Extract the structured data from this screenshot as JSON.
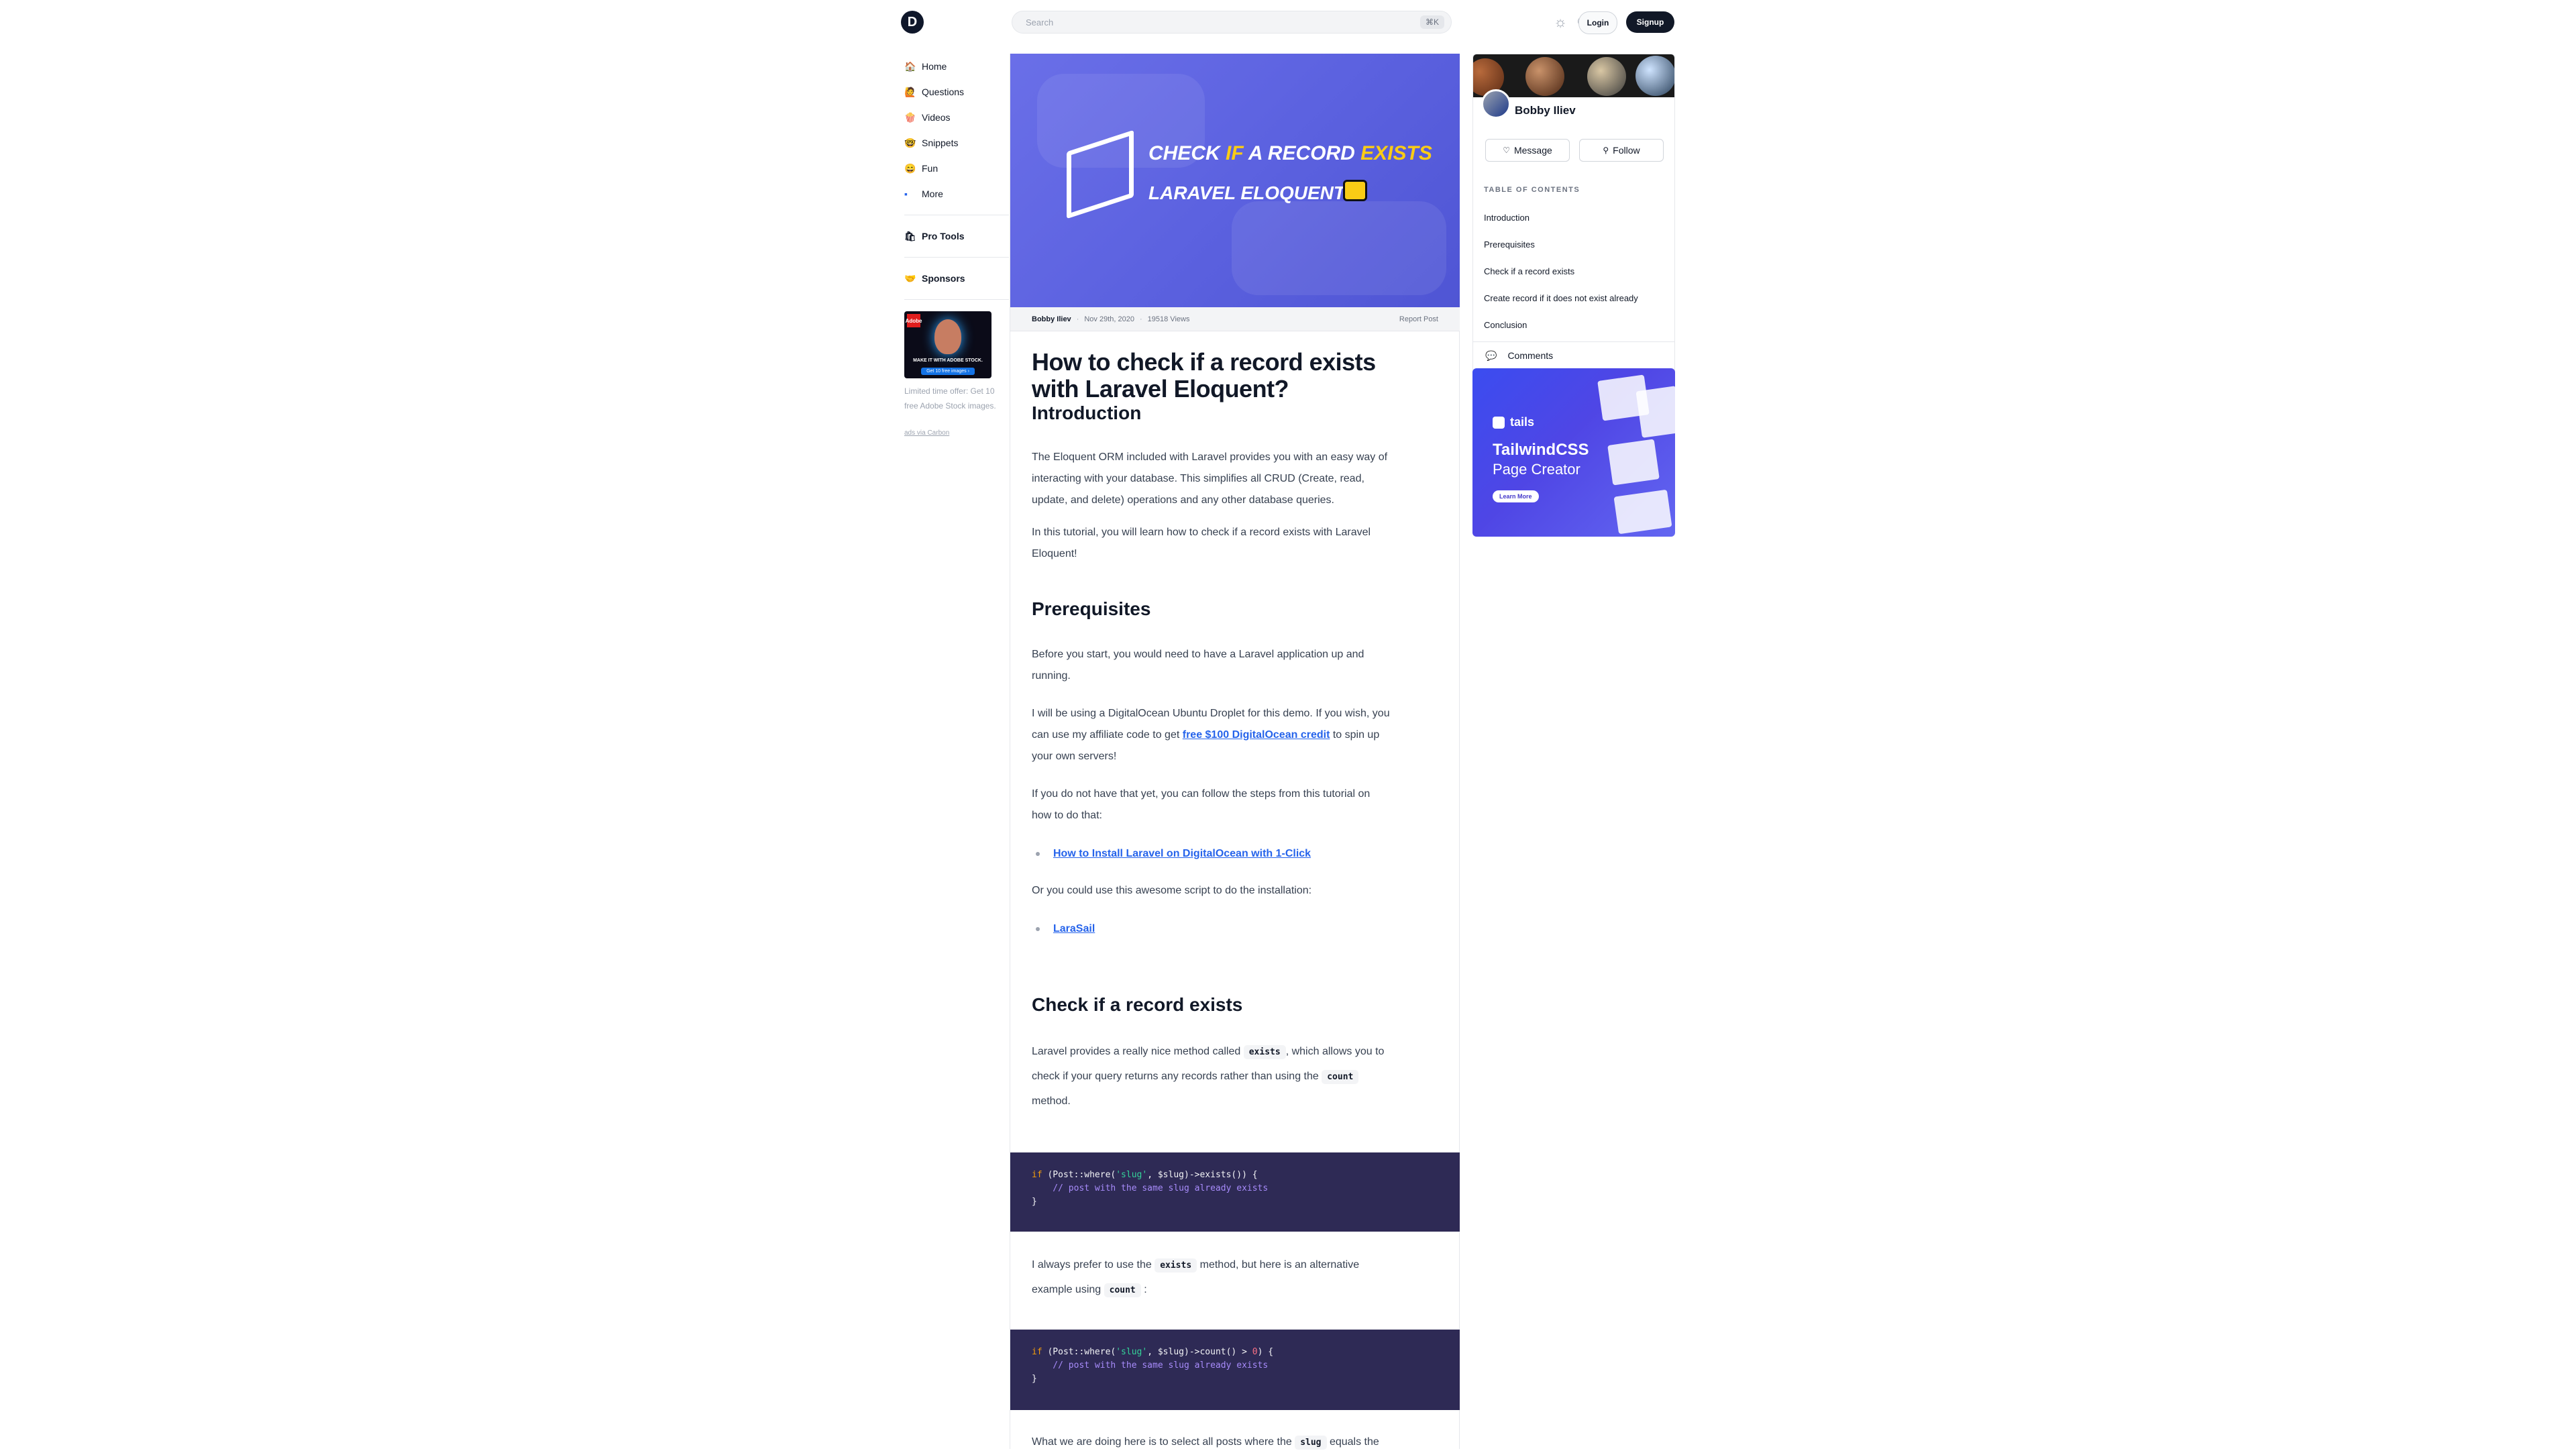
{
  "header": {
    "logo": "D",
    "search_placeholder": "Search",
    "search_shortcut": "⌘K",
    "theme_toggle": "☼ ☾",
    "login_label": "Login",
    "signup_label": "Signup"
  },
  "sidebar": {
    "items": [
      {
        "icon": "🏠",
        "label": "Home"
      },
      {
        "icon": "🙋",
        "label": "Questions"
      },
      {
        "icon": "🍿",
        "label": "Videos"
      },
      {
        "icon": "🤓",
        "label": "Snippets"
      },
      {
        "icon": "😄",
        "label": "Fun"
      },
      {
        "icon": "▪",
        "label": "More"
      }
    ],
    "pro_tools": {
      "icon": "🛍",
      "label": "Pro Tools"
    },
    "sponsors": {
      "icon": "🤝",
      "label": "Sponsors"
    },
    "ad": {
      "caption": "MAKE IT WITH ADOBE STOCK.",
      "cta": "Get 10 free images ›",
      "badge": "Adobe",
      "text": "Limited time offer: Get 10 free Adobe Stock images.",
      "link": "ads via Carbon"
    }
  },
  "article": {
    "hero": {
      "line1_a": "CHECK ",
      "line1_b": "IF",
      "line1_c": " A RECORD ",
      "line1_d": "EXISTS",
      "line2": "LARAVEL ELOQUENT"
    },
    "meta": {
      "author": "Bobby Iliev",
      "date": "Nov 29th, 2020",
      "views": "19518 Views",
      "report": "Report Post"
    },
    "title_line1": "How to check if a record exists",
    "title_line2": "with Laravel Eloquent?",
    "intro_heading": "Introduction",
    "intro_p1_l1": "The Eloquent ORM included with Laravel provides you with an easy way of",
    "intro_p1_l2": "interacting with your database. This simplifies all CRUD (Create, read,",
    "intro_p1_l3": "update, and delete) operations and any other database queries.",
    "intro_p2_l1": "In this tutorial, you will learn how to check if a record exists with Laravel",
    "intro_p2_l2": "Eloquent!",
    "prereq_heading": "Prerequisites",
    "prereq_p1_l1": "Before you start, you would need to have a Laravel application up and",
    "prereq_p1_l2": "running.",
    "prereq_p2_l1": "I will be using a DigitalOcean Ubuntu Droplet for this demo. If you wish, you",
    "prereq_p2_l2a": "can use my affiliate code to get ",
    "prereq_p2_link": "free $100 DigitalOcean credit",
    "prereq_p2_l2b": " to spin up",
    "prereq_p2_l3": "your own servers!",
    "prereq_p3_l1": "If you do not have that yet, you can follow the steps from this tutorial on",
    "prereq_p3_l2": "how to do that:",
    "link_install": "How to Install Laravel on DigitalOcean with 1-Click",
    "prereq_p4": "Or you could use this awesome script to do the installation:",
    "link_larasail": "LaraSail",
    "check_heading": "Check if a record exists",
    "check_p1_a": "Laravel provides a really nice method called ",
    "check_p1_code1": "exists",
    "check_p1_b": ", which allows you to",
    "check_p1_c": "check if your query returns any records rather than using the ",
    "check_p1_code2": "count",
    "check_p1_d": "method.",
    "code1": {
      "kw": "if",
      "a": " (Post::where(",
      "str": "'slug'",
      "b": ", $slug)->exists()) {",
      "comment": "    // post with the same slug already exists",
      "close": "}"
    },
    "alt_p_a": "I always prefer to use the ",
    "alt_p_code1": "exists",
    "alt_p_b": " method, but here is an alternative",
    "alt_p_c": "example using ",
    "alt_p_code2": "count",
    "alt_p_d": " :",
    "code2": {
      "kw": "if",
      "a": " (Post::where(",
      "str": "'slug'",
      "b": ", $slug)->count() > ",
      "num": "0",
      "c": ") {",
      "comment": "    // post with the same slug already exists",
      "close": "}"
    },
    "last_p_a": "What we are doing here is to select all posts where the ",
    "last_p_code": "slug",
    "last_p_b": " equals the"
  },
  "profile": {
    "name": "Bobby Iliev",
    "message_label": "Message",
    "follow_label": "Follow",
    "toc_heading": "TABLE OF CONTENTS",
    "toc": [
      "Introduction",
      "Prerequisites",
      "Check if a record exists",
      "Create record if it does not exist already",
      "Conclusion"
    ],
    "comments_label": "Comments"
  },
  "tails_ad": {
    "brand": "tails",
    "title": "TailwindCSS",
    "subtitle": "Page Creator",
    "cta": "Learn More"
  }
}
